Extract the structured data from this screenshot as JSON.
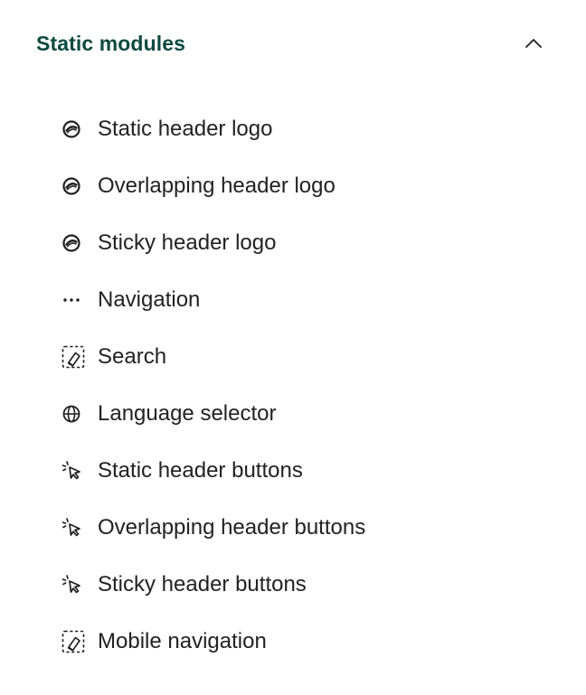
{
  "section": {
    "title": "Static modules",
    "expanded": true,
    "toggle_icon": "chevron-up-icon",
    "title_color": "#0c4a40"
  },
  "modules": [
    {
      "label": "Static header logo",
      "icon": "logo-icon"
    },
    {
      "label": "Overlapping header logo",
      "icon": "logo-icon"
    },
    {
      "label": "Sticky header logo",
      "icon": "logo-icon"
    },
    {
      "label": "Navigation",
      "icon": "ellipsis-icon"
    },
    {
      "label": "Search",
      "icon": "custom-module-icon"
    },
    {
      "label": "Language selector",
      "icon": "globe-icon"
    },
    {
      "label": "Static header buttons",
      "icon": "cursor-click-icon"
    },
    {
      "label": "Overlapping header buttons",
      "icon": "cursor-click-icon"
    },
    {
      "label": "Sticky header buttons",
      "icon": "cursor-click-icon"
    },
    {
      "label": "Mobile navigation",
      "icon": "custom-module-icon"
    }
  ]
}
